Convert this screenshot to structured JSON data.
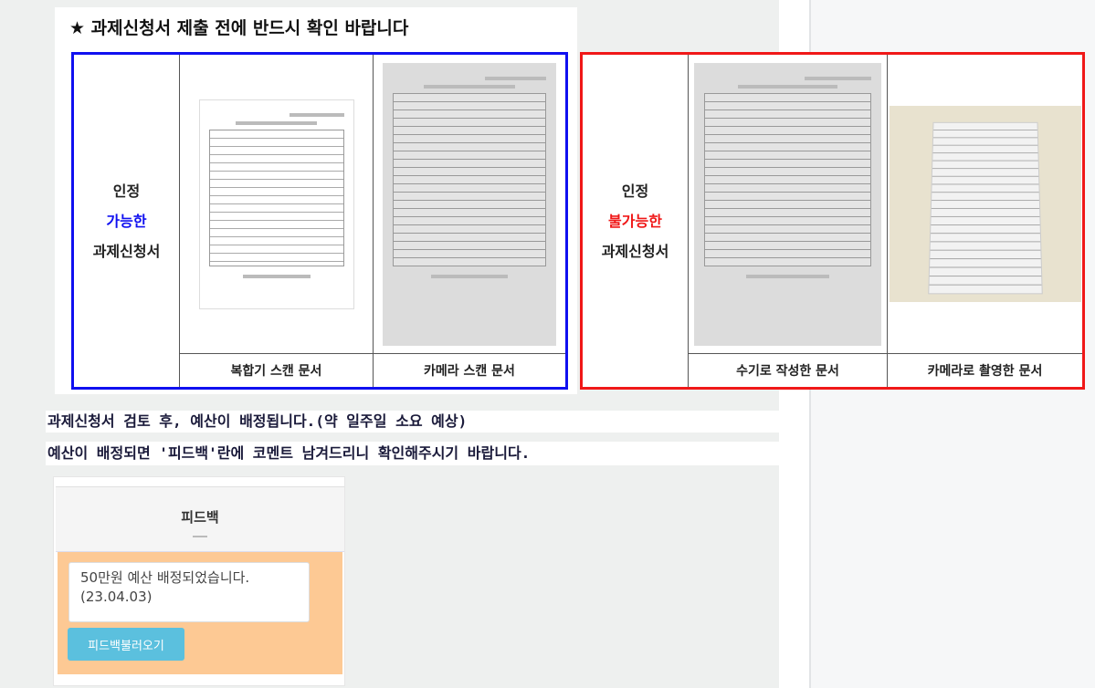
{
  "title": "★ 과제신청서 제출 전에 반드시 확인 바랍니다",
  "accepted": {
    "label_top": "인정",
    "label_mid": "가능한",
    "label_bottom": "과제신청서",
    "color": "#1010f0",
    "captions": [
      "복합기 스캔 문서",
      "카메라 스캔 문서"
    ]
  },
  "rejected": {
    "label_top": "인정",
    "label_mid": "불가능한",
    "label_bottom": "과제신청서",
    "color": "#f01818",
    "captions": [
      "수기로 작성한 문서",
      "카메라로 촬영한 문서"
    ]
  },
  "notes": [
    "과제신청서 검토 후, 예산이 배정됩니다.(약 일주일 소요 예상)",
    "예산이 배정되면 '피드백'란에 코멘트 남겨드리니 확인해주시기 바랍니다."
  ],
  "feedback": {
    "title": "피드백",
    "text": "50만원 예산 배정되었습니다.\n(23.04.03)",
    "button": "피드백불러오기"
  }
}
